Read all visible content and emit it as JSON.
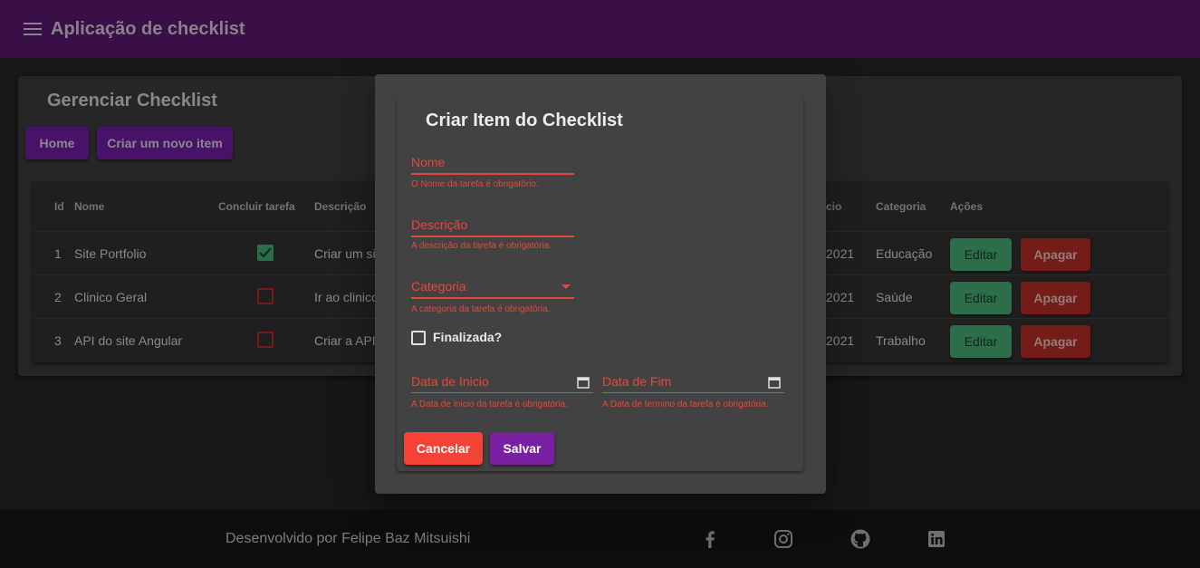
{
  "toolbar": {
    "title": "Aplicação de checklist",
    "menu_icon": "menu-icon"
  },
  "page": {
    "title": "Gerenciar Checklist",
    "buttons": {
      "home": "Home",
      "new_item": "Criar um novo item"
    }
  },
  "table": {
    "headers": {
      "id": "Id",
      "name": "Nome",
      "complete": "Concluir tarefa",
      "description": "Descrição",
      "start_partial": "cio",
      "category": "Categoria",
      "actions": "Ações"
    },
    "rows": [
      {
        "id": "1",
        "name": "Site Portfolio",
        "done": true,
        "description": "Criar um si",
        "date": "2021",
        "category": "Educação",
        "edit": "Editar",
        "delete": "Apagar"
      },
      {
        "id": "2",
        "name": "Clinico Geral",
        "done": false,
        "description": "Ir ao clinico",
        "date": "2021",
        "category": "Saúde",
        "edit": "Editar",
        "delete": "Apagar"
      },
      {
        "id": "3",
        "name": "API do site Angular",
        "done": false,
        "description": "Criar a API",
        "date": "2021",
        "category": "Trabalho",
        "edit": "Editar",
        "delete": "Apagar"
      }
    ]
  },
  "dialog": {
    "title": "Criar Item do Checklist",
    "fields": {
      "name": {
        "label": "Nome",
        "error": "O Nome da tarefa é obrigatório."
      },
      "description": {
        "label": "Descrição",
        "error": "A descrição da tarefa é obrigatória."
      },
      "category": {
        "label": "Categoria",
        "error": "A categoria da tarefa é obrigatória."
      },
      "finished": {
        "label": "Finalizada?"
      },
      "start_date": {
        "label": "Data de Inicio",
        "error": "A Data de inicio da tarefa é obrigatória."
      },
      "end_date": {
        "label": "Data de Fim",
        "error": "A Data de termino da tarefa é obrigatória."
      }
    },
    "buttons": {
      "cancel": "Cancelar",
      "save": "Salvar"
    }
  },
  "footer": {
    "text": "Desenvolvido por Felipe Baz Mitsuishi",
    "icons": [
      "facebook-icon",
      "instagram-icon",
      "github-icon",
      "linkedin-icon"
    ]
  },
  "colors": {
    "primary": "#56176b",
    "accent": "#7b1fa2",
    "warn": "#f44336",
    "success": "#43a36d",
    "danger": "#ab2a22",
    "error_text": "#e5473d"
  }
}
